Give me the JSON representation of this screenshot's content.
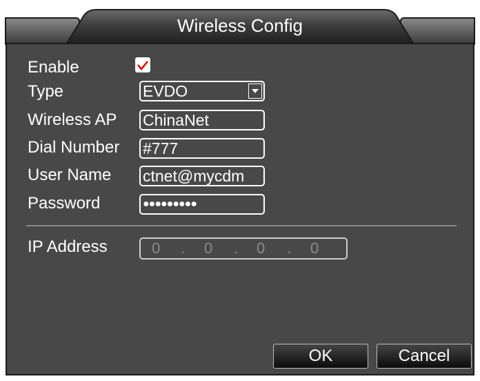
{
  "dialog": {
    "title": "Wireless Config"
  },
  "form": {
    "enable_label": "Enable",
    "enable_checked": true,
    "type_label": "Type",
    "type_value": "EVDO",
    "ap_label": "Wireless AP",
    "ap_value": "ChinaNet",
    "dial_label": "Dial Number",
    "dial_value": "#777",
    "user_label": "User Name",
    "user_value": "ctnet@mycdm",
    "password_label": "Password",
    "password_value": "●●●●●●●●●",
    "ip_label": "IP Address",
    "ip_octets": [
      "0",
      "0",
      "0",
      "0"
    ]
  },
  "buttons": {
    "ok": "OK",
    "cancel": "Cancel"
  },
  "colors": {
    "panel": "#484848",
    "text": "#ffffff",
    "check": "#e00000",
    "disabled_text": "#8c8c8c"
  },
  "icons": {
    "checkbox": "checkmark-icon",
    "dropdown": "chevron-down-icon"
  }
}
